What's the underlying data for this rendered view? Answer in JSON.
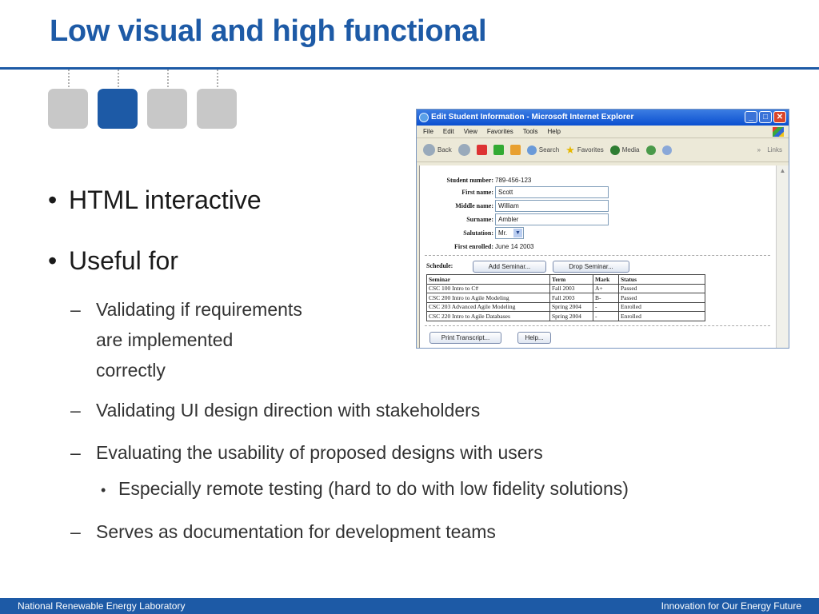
{
  "slide": {
    "title": "Low visual and high functional",
    "bullets": {
      "b1": "HTML interactive",
      "b2": "Useful for",
      "sub1": "Validating if requirements are implemented correctly",
      "sub1_l1": "Validating if requirements",
      "sub1_l2": "are implemented",
      "sub1_l3": "correctly",
      "sub2": "Validating UI design direction with stakeholders",
      "sub3": "Evaluating the usability of proposed designs with users",
      "subsub1": "Especially remote testing (hard to do with low fidelity solutions)",
      "sub4": "Serves as documentation for development teams"
    },
    "stepper": {
      "count": 4,
      "active_index": 1
    }
  },
  "browser": {
    "title": "Edit Student Information - Microsoft Internet Explorer",
    "menu": [
      "File",
      "Edit",
      "View",
      "Favorites",
      "Tools",
      "Help"
    ],
    "toolbar": {
      "back": "Back",
      "search": "Search",
      "favorites": "Favorites",
      "media": "Media",
      "links": "Links",
      "chevron": "»"
    },
    "form": {
      "student_number_label": "Student number:",
      "student_number": "789-456-123",
      "first_name_label": "First name:",
      "first_name": "Scott",
      "middle_name_label": "Middle name:",
      "middle_name": "William",
      "surname_label": "Surname:",
      "surname": "Ambler",
      "salutation_label": "Salutation:",
      "salutation": "Mr.",
      "first_enrolled_label": "First enrolled:",
      "first_enrolled": "June 14 2003"
    },
    "schedule_label": "Schedule:",
    "add_seminar": "Add Seminar...",
    "drop_seminar": "Drop Seminar...",
    "table": {
      "headers": [
        "Seminar",
        "Term",
        "Mark",
        "Status"
      ],
      "rows": [
        [
          "CSC 100 Intro to C#",
          "Fall 2003",
          "A+",
          "Passed"
        ],
        [
          "CSC 200 Intro to Agile Modeling",
          "Fall 2003",
          "B-",
          "Passed"
        ],
        [
          "CSC 203 Advanced Agile Modeling",
          "Spring 2004",
          "-",
          "Enrolled"
        ],
        [
          "CSC 220 Intro to Agile Databases",
          "Spring 2004",
          "-",
          "Enrolled"
        ]
      ]
    },
    "print_transcript": "Print Transcript...",
    "help": "Help..."
  },
  "footer": {
    "left": "National Renewable Energy Laboratory",
    "right": "Innovation for Our Energy Future"
  },
  "colors": {
    "brand_blue": "#1d5aa6",
    "step_gray": "#c8c8c8"
  }
}
